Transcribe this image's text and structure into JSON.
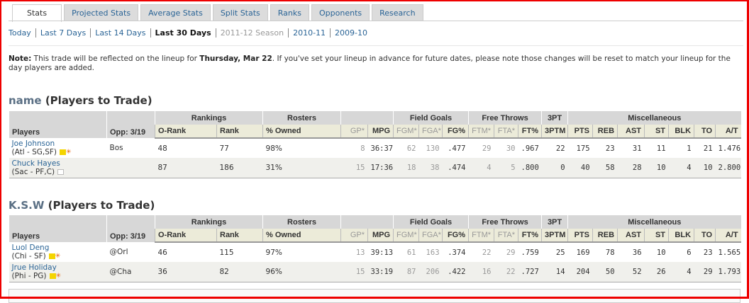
{
  "tabs": [
    {
      "label": "Stats",
      "active": true
    },
    {
      "label": "Projected Stats"
    },
    {
      "label": "Average Stats"
    },
    {
      "label": "Split Stats"
    },
    {
      "label": "Ranks"
    },
    {
      "label": "Opponents"
    },
    {
      "label": "Research"
    }
  ],
  "ranges": [
    {
      "label": "Today"
    },
    {
      "label": "Last 7 Days"
    },
    {
      "label": "Last 14 Days"
    },
    {
      "label": "Last 30 Days",
      "current": true
    },
    {
      "label": "2011-12 Season",
      "disabled": true
    },
    {
      "label": "2010-11"
    },
    {
      "label": "2009-10"
    }
  ],
  "note": {
    "prefix": "Note:",
    "text1": " This trade will be reflected on the lineup for ",
    "date": "Thursday, Mar 22",
    "text2": ". If you've set your lineup in advance for future dates, please note those changes will be reset to match your lineup for the day players are added."
  },
  "columns_groups": [
    {
      "label": "",
      "span": 2
    },
    {
      "label": "Rankings",
      "span": 2
    },
    {
      "label": "Rosters",
      "span": 1
    },
    {
      "label": "",
      "span": 2
    },
    {
      "label": "Field Goals",
      "span": 3
    },
    {
      "label": "Free Throws",
      "span": 3
    },
    {
      "label": "3PT",
      "span": 1
    },
    {
      "label": "Miscellaneous",
      "span": 7
    }
  ],
  "columns": [
    "Players",
    "Opp: 3/19",
    "O-Rank",
    "Rank",
    "% Owned",
    "GP*",
    "MPG",
    "FGM*",
    "FGA*",
    "FG%",
    "FTM*",
    "FTA*",
    "FT%",
    "3PTM",
    "PTS",
    "REB",
    "AST",
    "ST",
    "BLK",
    "TO",
    "A/T"
  ],
  "sections": [
    {
      "owner": "name",
      "suffix": " (Players to Trade)",
      "players": [
        {
          "name": "Joe Johnson",
          "info": "(Atl - SG,SF)",
          "icon": "note-new-icon",
          "opp": "Bos",
          "stats": [
            "48",
            "77",
            "98%",
            "8",
            "36:37",
            "62",
            "130",
            ".477",
            "29",
            "30",
            ".967",
            "22",
            "175",
            "23",
            "31",
            "11",
            "1",
            "21",
            "1.476"
          ]
        },
        {
          "name": "Chuck Hayes",
          "info": "(Sac - PF,C)",
          "icon": "note-icon",
          "opp": "",
          "stats": [
            "87",
            "186",
            "31%",
            "15",
            "17:36",
            "18",
            "38",
            ".474",
            "4",
            "5",
            ".800",
            "0",
            "40",
            "58",
            "28",
            "10",
            "4",
            "10",
            "2.800"
          ]
        }
      ]
    },
    {
      "owner": "K.S.W",
      "suffix": " (Players to Trade)",
      "players": [
        {
          "name": "Luol Deng",
          "info": "(Chi - SF)",
          "icon": "note-new-icon",
          "opp": "@Orl",
          "stats": [
            "46",
            "115",
            "97%",
            "13",
            "39:13",
            "61",
            "163",
            ".374",
            "22",
            "29",
            ".759",
            "25",
            "169",
            "78",
            "36",
            "10",
            "6",
            "23",
            "1.565"
          ]
        },
        {
          "name": "Jrue Holiday",
          "info": "(Phi - PG)",
          "icon": "note-new-icon",
          "opp": "@Cha",
          "stats": [
            "36",
            "82",
            "96%",
            "15",
            "33:19",
            "87",
            "206",
            ".422",
            "16",
            "22",
            ".727",
            "14",
            "204",
            "50",
            "52",
            "26",
            "4",
            "29",
            "1.793"
          ]
        }
      ]
    }
  ]
}
